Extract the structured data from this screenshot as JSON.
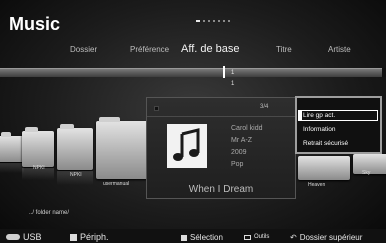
{
  "header": {
    "title": "Music"
  },
  "tabs": [
    {
      "label": "Dossier"
    },
    {
      "label": "Préférence"
    },
    {
      "label": "Aff. de base",
      "active": true
    },
    {
      "label": "Titre"
    },
    {
      "label": "Artiste"
    }
  ],
  "slider": {
    "marker_top": "1",
    "marker_bottom": "1"
  },
  "folders": [
    {
      "label": "NPKI"
    },
    {
      "label": "NPKI"
    },
    {
      "label": "usermanual"
    },
    {
      "label": "Heaven"
    },
    {
      "label": "Sky"
    }
  ],
  "info_panel": {
    "count": "3/4",
    "artist": "Carol kidd",
    "album": "Mr A-Z",
    "year": "2009",
    "genre": "Pop",
    "song_title": "When I Dream",
    "icon": "music-note-icon"
  },
  "context_menu": {
    "items": [
      {
        "label": "Lire gp act.",
        "selected": true
      },
      {
        "label": "Information"
      },
      {
        "label": "Retrait sécurisé"
      }
    ]
  },
  "path": "../ folder name/",
  "bottom_bar": {
    "usb_label": "USB",
    "device_label": "Périph.",
    "selection_label": "Sélection",
    "tools_label": "Outils",
    "return_label": "Dossier supérieur"
  },
  "colors": {
    "background": "#2a2a2a",
    "menu_border": "#9e9e9e",
    "note_box": "#f2f2f2"
  }
}
